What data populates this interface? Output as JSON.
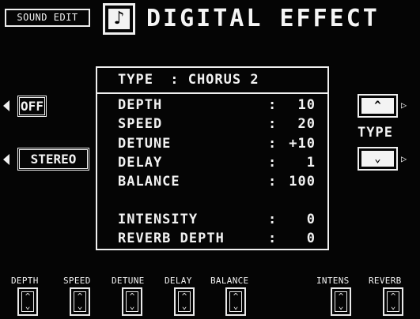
{
  "header": {
    "sound_edit": "SOUND EDIT",
    "title": "DIGITAL EFFECT",
    "note_icon": "♪"
  },
  "left_buttons": {
    "off": "OFF",
    "stereo": "STEREO"
  },
  "panel": {
    "type_label": "TYPE",
    "type_sep": ":",
    "type_value": "CHORUS 2",
    "params": [
      {
        "label": "DEPTH",
        "value": "10"
      },
      {
        "label": "SPEED",
        "value": "20"
      },
      {
        "label": "DETUNE",
        "value": "+10"
      },
      {
        "label": "DELAY",
        "value": "1"
      },
      {
        "label": "BALANCE",
        "value": "100"
      }
    ],
    "extra_params": [
      {
        "label": "INTENSITY",
        "value": "0"
      },
      {
        "label": "REVERB DEPTH",
        "value": "0"
      }
    ],
    "colon": ":"
  },
  "type_control": {
    "label": "TYPE",
    "up_icon": "^",
    "down_icon": "⌄"
  },
  "bottom": {
    "labels": [
      "DEPTH",
      "SPEED",
      "DETUNE",
      "DELAY",
      "BALANCE",
      "INTENS",
      "REVERB"
    ],
    "up": "^",
    "down": "⌄"
  }
}
